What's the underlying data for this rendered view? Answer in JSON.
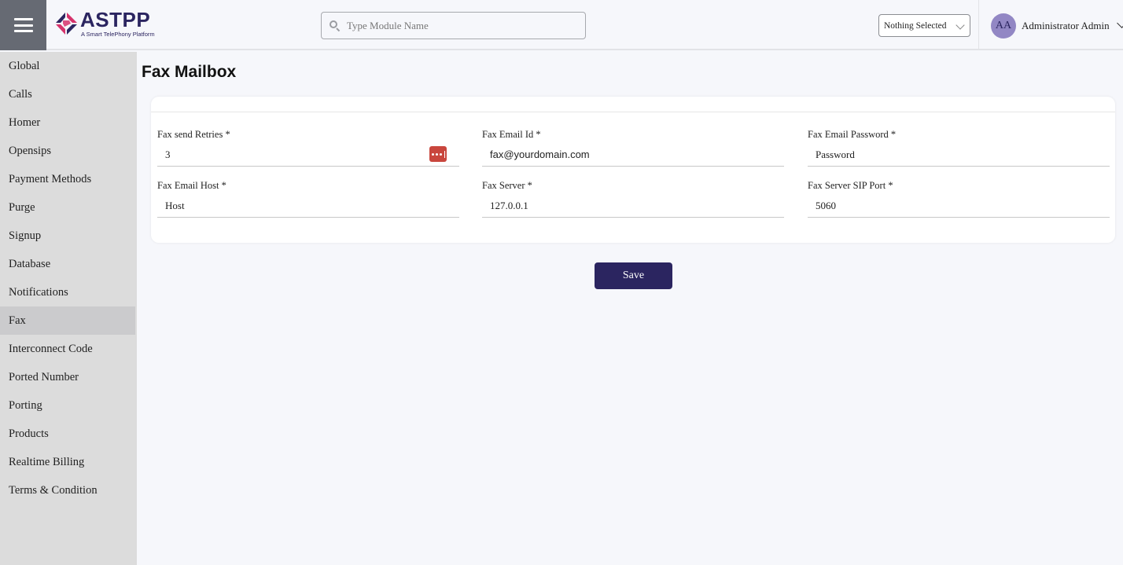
{
  "header": {
    "logo": {
      "name": "ASTPP",
      "tagline": "A Smart TelePhony Platform"
    },
    "search": {
      "placeholder": "Type Module Name",
      "value": ""
    },
    "select": {
      "selected": "Nothing Selected"
    },
    "user": {
      "initials": "AA",
      "name": "Administrator Admin"
    },
    "colors": {
      "brand": "#2b2560",
      "avatar": "#9287c4"
    }
  },
  "sidebar": {
    "items": [
      {
        "label": "Global"
      },
      {
        "label": "Calls"
      },
      {
        "label": "Homer"
      },
      {
        "label": "Opensips"
      },
      {
        "label": "Payment Methods"
      },
      {
        "label": "Purge"
      },
      {
        "label": "Signup"
      },
      {
        "label": "Database"
      },
      {
        "label": "Notifications"
      },
      {
        "label": "Fax",
        "active": true
      },
      {
        "label": "Interconnect Code"
      },
      {
        "label": "Ported Number"
      },
      {
        "label": "Porting"
      },
      {
        "label": "Products"
      },
      {
        "label": "Realtime Billing"
      },
      {
        "label": "Terms & Condition"
      }
    ]
  },
  "main": {
    "title": "Fax Mailbox",
    "fields": [
      {
        "label": "Fax send Retries *",
        "value": "3"
      },
      {
        "label": "Fax Email Id *",
        "value": "fax@yourdomain.com"
      },
      {
        "label": "Fax Email Password *",
        "value": "Password"
      },
      {
        "label": "Fax Email Host *",
        "value": "Host"
      },
      {
        "label": "Fax Server *",
        "value": "127.0.0.1"
      },
      {
        "label": "Fax Server SIP Port *",
        "value": "5060"
      }
    ],
    "save_label": "Save"
  }
}
